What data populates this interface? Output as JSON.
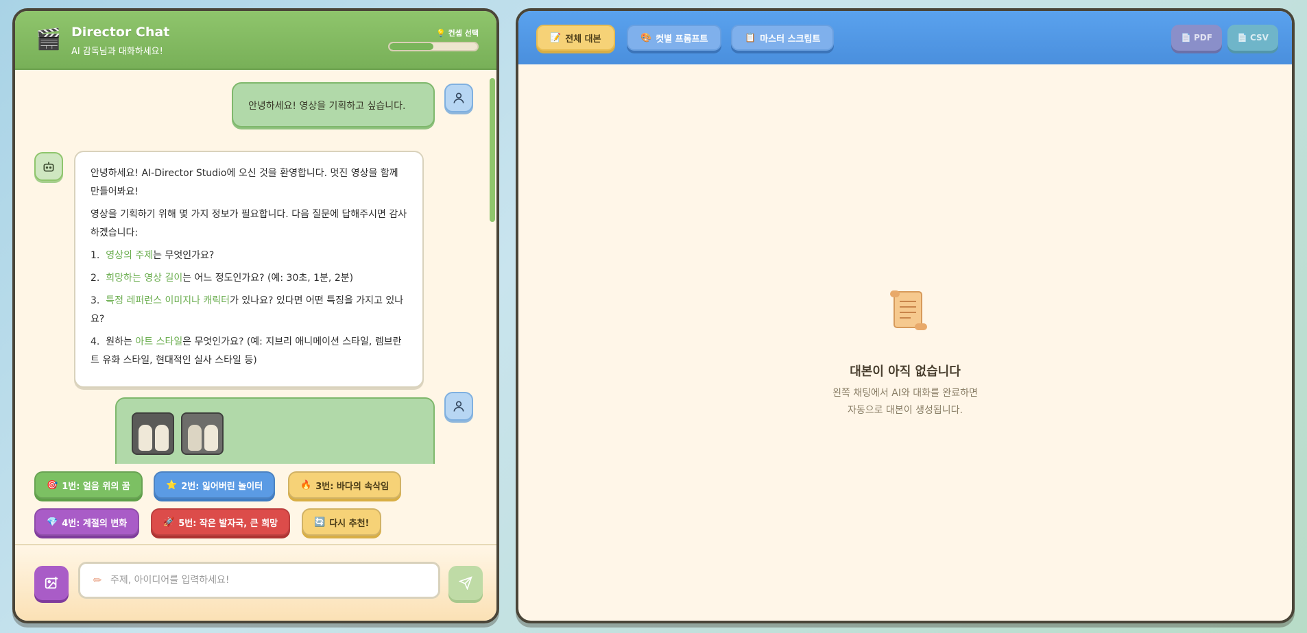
{
  "header": {
    "icon": "clapperboard-icon",
    "title": "Director Chat",
    "subtitle": "AI 감독님과 대화하세요!",
    "concept_label": "💡 컨셉 선택",
    "progress_fraction": 0.5
  },
  "chat": {
    "user_message_1": "안녕하세요! 영상을 기획하고 싶습니다.",
    "bot_intro_1": "안녕하세요! AI-Director Studio에 오신 것을 환영합니다. 멋진 영상을 함께 만들어봐요!",
    "bot_intro_2": "영상을 기획하기 위해 몇 가지 정보가 필요합니다. 다음 질문에 답해주시면 감사하겠습니다:",
    "questions": [
      {
        "num": "1.",
        "highlight": "영상의 주제",
        "rest": "는 무엇인가요?"
      },
      {
        "num": "2.",
        "highlight": "희망하는 영상 길이",
        "rest": "는 어느 정도인가요? (예: 30초, 1분, 2분)"
      },
      {
        "num": "3.",
        "highlight": "특정 레퍼런스 이미지나 캐릭터",
        "rest": "가 있나요? 있다면 어떤 특징을 가지고 있나요?"
      },
      {
        "num": "4.",
        "pre": "원하는 ",
        "highlight": "아트 스타일",
        "rest": "은 무엇인가요? (예: 지브리 애니메이션 스타일, 렘브란트 유화 스타일, 현대적인 실사 스타일 등)"
      }
    ]
  },
  "suggestions": [
    {
      "icon": "🎯",
      "label": "1번: 얼음 위의 꿈",
      "color": "green"
    },
    {
      "icon": "⭐",
      "label": "2번: 잃어버린 놀이터",
      "color": "blue"
    },
    {
      "icon": "🔥",
      "label": "3번: 바다의 속삭임",
      "color": "yellow"
    },
    {
      "icon": "💎",
      "label": "4번: 계절의 변화",
      "color": "purple"
    },
    {
      "icon": "🚀",
      "label": "5번: 작은 발자국, 큰 희망",
      "color": "red"
    },
    {
      "icon": "🔄",
      "label": "다시 추천!",
      "color": "yellow"
    }
  ],
  "input": {
    "placeholder": "주제, 아이디어를 입력하세요!"
  },
  "toolbar": {
    "tabs": [
      {
        "icon": "📝",
        "label": "전체 대본"
      },
      {
        "icon": "🎨",
        "label": "컷별 프롬프트"
      },
      {
        "icon": "📋",
        "label": "마스터 스크립트"
      }
    ],
    "export_pdf": "PDF",
    "export_csv": "CSV"
  },
  "empty_state": {
    "title": "대본이 아직 없습니다",
    "line1": "왼쪽 채팅에서 AI와 대화를 완료하면",
    "line2": "자동으로 대본이 생성됩니다."
  }
}
